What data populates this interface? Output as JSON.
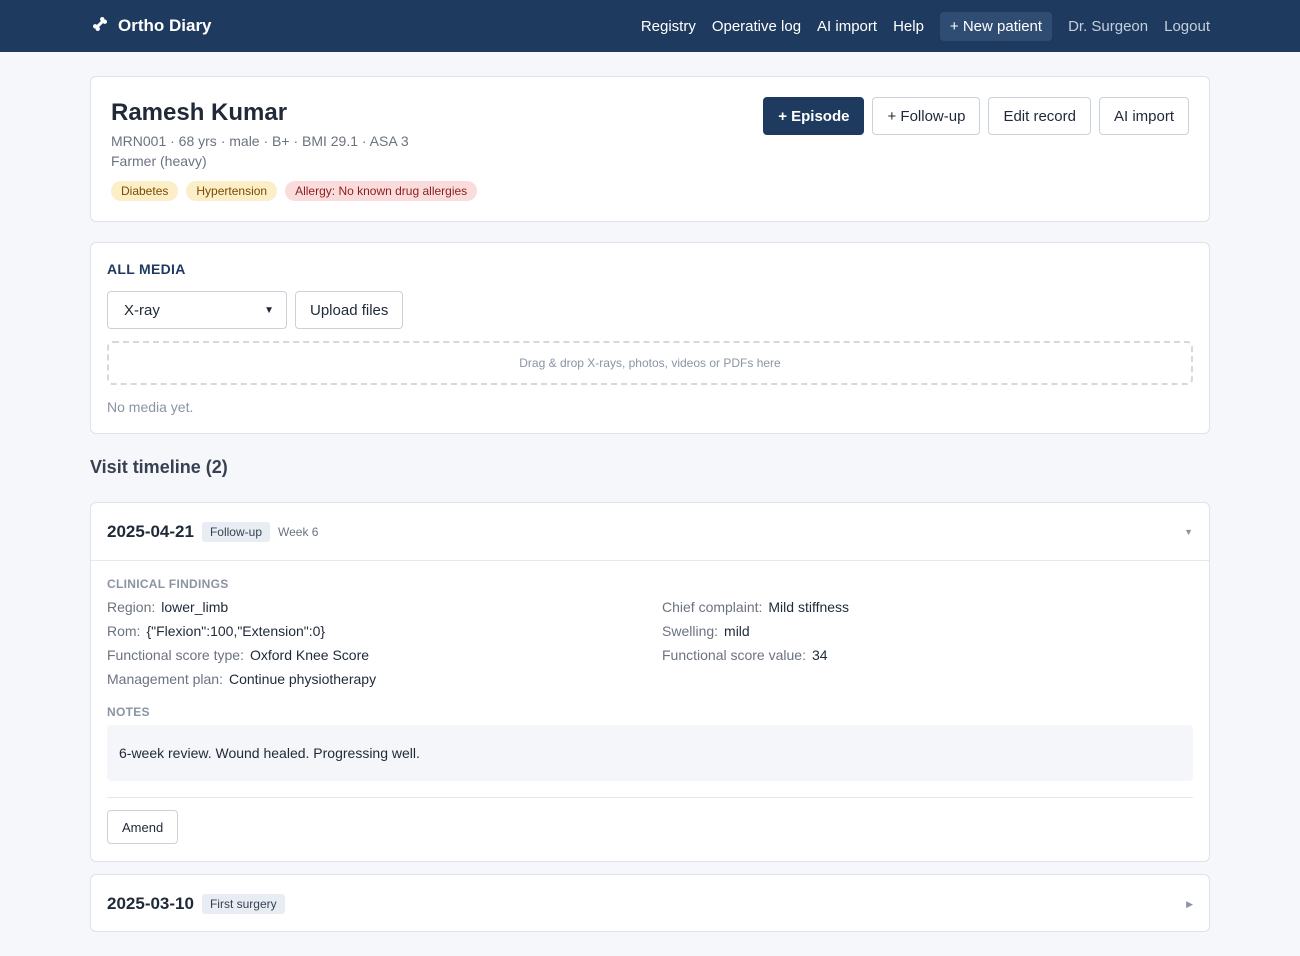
{
  "nav": {
    "brand": "Ortho Diary",
    "links": [
      "Registry",
      "Operative log",
      "AI import",
      "Help"
    ],
    "new_patient": "+ New patient",
    "user": "Dr. Surgeon",
    "logout": "Logout"
  },
  "patient": {
    "name": "Ramesh Kumar",
    "meta": "MRN001 · 68 yrs · male · B+ · BMI 29.1 · ASA 3",
    "occupation": "Farmer (heavy)",
    "tags": [
      "Diabetes",
      "Hypertension",
      "Allergy: No known drug allergies"
    ],
    "actions": [
      "+ Episode",
      "+ Follow-up",
      "Edit record",
      "AI import"
    ]
  },
  "media": {
    "title": "ALL MEDIA",
    "selected_type": "X-ray",
    "upload": "Upload files",
    "drop_hint": "Drag & drop X-rays, photos, videos or PDFs here",
    "empty": "No media yet."
  },
  "timeline": {
    "heading": "Visit timeline (2)",
    "visits": [
      {
        "date": "2025-04-21",
        "type": "Follow-up",
        "week": "Week 6",
        "toggle": "▼",
        "findings_label": "CLINICAL FINDINGS",
        "findings": [
          {
            "k": "Region:",
            "v": "lower_limb"
          },
          {
            "k": "Chief complaint:",
            "v": "Mild stiffness"
          },
          {
            "k": "Rom:",
            "v": "{\"Flexion\":100,\"Extension\":0}"
          },
          {
            "k": "Swelling:",
            "v": "mild"
          },
          {
            "k": "Functional score type:",
            "v": "Oxford Knee Score"
          },
          {
            "k": "Functional score value:",
            "v": "34"
          },
          {
            "k": "Management plan:",
            "v": "Continue physiotherapy"
          }
        ],
        "notes_label": "NOTES",
        "notes": "6-week review. Wound healed. Progressing well.",
        "amend": "Amend"
      },
      {
        "date": "2025-03-10",
        "type": "First surgery",
        "toggle": "▶"
      }
    ]
  }
}
